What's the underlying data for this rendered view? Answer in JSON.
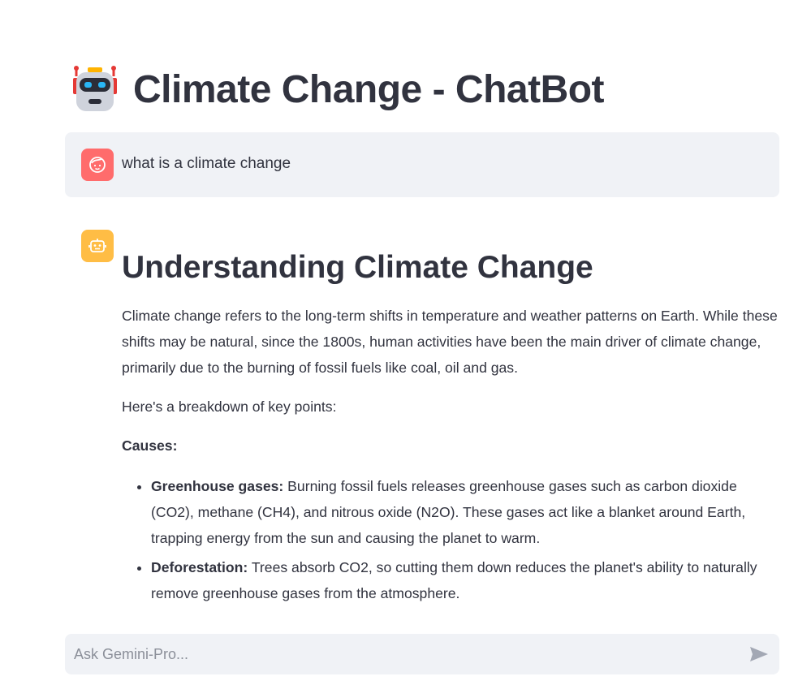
{
  "header": {
    "title": "Climate Change - ChatBot",
    "title_icon": "robot-emoji-icon"
  },
  "messages": [
    {
      "role": "user",
      "avatar_icon": "user-face-icon",
      "avatar_color": "#ff6c6c",
      "text": "what is a climate change"
    },
    {
      "role": "assistant",
      "avatar_icon": "robot-icon",
      "avatar_color": "#ffbd45",
      "heading": "Understanding Climate Change",
      "intro": "Climate change refers to the long-term shifts in temperature and weather patterns on Earth. While these shifts may be natural, since the 1800s, human activities have been the main driver of climate change, primarily due to the burning of fossil fuels like coal, oil and gas.",
      "breakdown": "Here's a breakdown of key points:",
      "section_label": "Causes:",
      "bullets": [
        {
          "term": "Greenhouse gases:",
          "text": " Burning fossil fuels releases greenhouse gases such as carbon dioxide (CO2), methane (CH4), and nitrous oxide (N2O). These gases act like a blanket around Earth, trapping energy from the sun and causing the planet to warm."
        },
        {
          "term": "Deforestation:",
          "text": " Trees absorb CO2, so cutting them down reduces the planet's ability to naturally remove greenhouse gases from the atmosphere."
        }
      ]
    }
  ],
  "chat_input": {
    "placeholder": "Ask Gemini-Pro...",
    "value": "",
    "send_icon": "send-icon"
  },
  "colors": {
    "text": "#31333f",
    "panel_bg": "#f0f2f6",
    "user_avatar": "#ff6c6c",
    "bot_avatar": "#ffbd45",
    "send_icon": "#a3a8b4"
  }
}
